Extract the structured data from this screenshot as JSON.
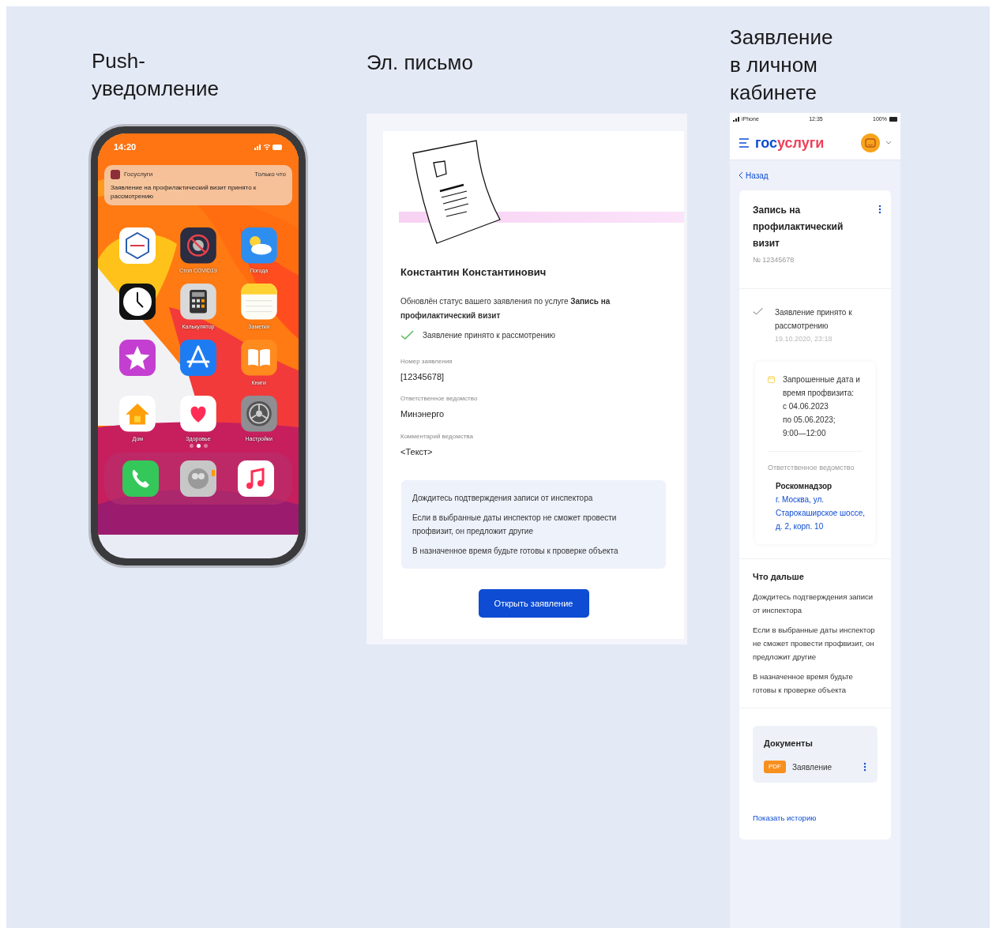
{
  "push": {
    "title": "Push-уведомление",
    "phone": {
      "time": "14:20",
      "notification": {
        "app": "Госуслуги",
        "when": "Только что",
        "text": "Заявление на профилактический визит принято к рассмотрению"
      },
      "apps": [
        {
          "kind": "gosuslugi"
        },
        {
          "kind": "virus",
          "label": "Стоп COVID19"
        },
        {
          "kind": "weather",
          "label": "Погода"
        },
        {
          "kind": "clock"
        },
        {
          "kind": "calculator",
          "label": "Калькулятор"
        },
        {
          "kind": "notes",
          "label": "Заметки"
        },
        {
          "kind": "star"
        },
        {
          "kind": "appstore"
        },
        {
          "kind": "books",
          "label": "Книги"
        },
        {
          "kind": "home",
          "label": "Дом"
        },
        {
          "kind": "health",
          "label": "Здоровье"
        },
        {
          "kind": "settings",
          "label": "Настройки"
        }
      ],
      "pages": [
        {
          "selected": false
        },
        {
          "selected": true
        },
        {
          "selected": false
        }
      ],
      "dock": [
        {
          "kind": "phone"
        },
        {
          "kind": "contacts"
        },
        {
          "kind": "music"
        }
      ]
    }
  },
  "email": {
    "title": "Эл. письмо",
    "greeting": "Константин Константинович",
    "intro": "Обновлён статус вашего заявления по услуге **Запись на профилактический визит**",
    "status": "Заявление принято к рассмотрению",
    "fields": [
      {
        "label": "Номер заявления",
        "value": "[12345678]"
      },
      {
        "label": "Ответственное ведомство",
        "value": "Минэнерго"
      },
      {
        "label": "Комментарий ведомства",
        "value": "<Текст>"
      }
    ],
    "notes": [
      "Дождитесь подтверждения записи от инспектора",
      "Если в выбранные даты инспектор не сможет провести профвизит, он предложит другие",
      "В назначенное время будьте готовы к проверке объекта"
    ],
    "button": "Открыть заявление"
  },
  "cabinet": {
    "title": "Заявление в личном кабинете",
    "status_bar": {
      "carrier": "iPhone",
      "time": "12:35",
      "battery": "100%"
    },
    "logo": {
      "part_1": "гос",
      "part_2": "услуги"
    },
    "back": "Назад",
    "service": {
      "title": "Запись на профилактический визит",
      "number": "№ 12345678"
    },
    "history": [
      {
        "text": "Заявление принято к рассмотрению",
        "date": "19.10.2020, 23:18"
      }
    ],
    "request": [
      "Запрошенные дата и время профвизита:",
      "с 04.06.2023",
      "по 05.06.2023;",
      "9:00—12:00"
    ],
    "agency": {
      "label": "Ответственное ведомство",
      "name": "Роскомнадзор",
      "address": "г. Москва, ул. Старокаширское шоссе, д. 2, корп. 10"
    },
    "next": {
      "title": "Что дальше",
      "paragraphs": [
        "Дождитесь подтверждения записи от инспектора",
        "Если в выбранные даты инспектор не сможет провести профвизит, он предложит другие",
        "В назначенное время будьте готовы к проверке объекта"
      ]
    },
    "documents": {
      "title": "Документы",
      "items": [
        {
          "badge": "PDF",
          "name": "Заявление"
        }
      ]
    },
    "history_link": "Показать историю"
  }
}
